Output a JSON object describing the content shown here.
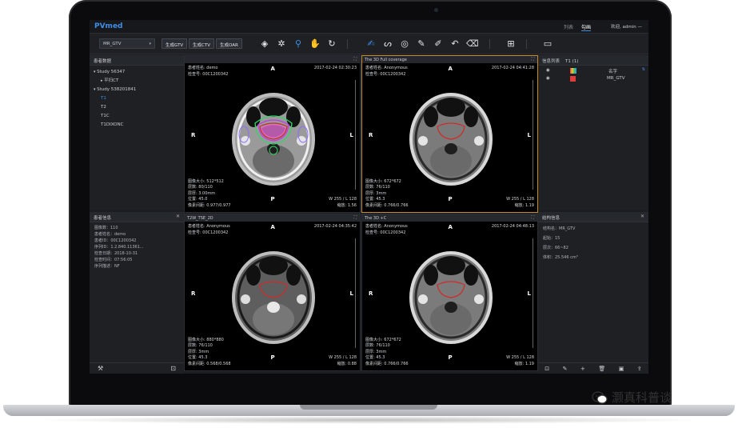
{
  "app": {
    "logo": "PVmed",
    "tabs": [
      "列表",
      "勾画"
    ],
    "active_tab": 1,
    "user": "欢迎, admin"
  },
  "toolbar": {
    "structure_select": "MR_GTV",
    "btn_gtv": "生成GTV",
    "btn_ctv": "生成CTV",
    "btn_oar": "生成OAR"
  },
  "patient_data": {
    "title": "患者数据",
    "items": [
      {
        "label": "Study 56347",
        "level": 0
      },
      {
        "label": "平扫CT",
        "level": 1
      },
      {
        "label": "Study 538201841",
        "level": 0
      },
      {
        "label": "T1",
        "level": 1
      },
      {
        "label": "T2",
        "level": 1
      },
      {
        "label": "T1C",
        "level": 1
      },
      {
        "label": "T1DIXONC",
        "level": 1
      }
    ]
  },
  "patient_info": {
    "title": "患者信息",
    "lines": [
      "图像数：110",
      "患者姓名：demo",
      "患者ID：00C1200342",
      "序列ID：1.2.840.11361...",
      "检查日期：2018-10-31",
      "检查时间：07:56:05",
      "序列描述：NF"
    ]
  },
  "viewports": [
    {
      "title": "",
      "name": "患者姓名: demo",
      "id": "检查号: 00C1200342",
      "datetime": "2017-02-24 02:30:23",
      "info": [
        "图像大小: 512*512",
        "层数: 80/110",
        "层厚: 3.00mm",
        "位置: 45.0",
        "像素间距: 0.977/0.977"
      ],
      "wl": "W 255 / L 128",
      "zoom": "缩放: 1.56",
      "modality": "ct"
    },
    {
      "title": "The 3D Full coverage",
      "name": "患者姓名: Anonymous",
      "id": "检查号: 00C1200342",
      "datetime": "2017-02-24 04:41:28",
      "info": [
        "图像大小: 672*672",
        "层数: 76/110",
        "层厚: 3mm",
        "位置: 45.3",
        "像素间距: 0.766/0.766"
      ],
      "wl": "W 255 / L 128",
      "zoom": "缩放: 1.19",
      "modality": "t1"
    },
    {
      "title": "T2W_TSE_2D",
      "name": "患者姓名: Anonymous",
      "id": "检查号: 00C1200342",
      "datetime": "2017-02-24 04:35:42",
      "info": [
        "图像大小: 880*880",
        "层数: 76/110",
        "层厚: 3mm",
        "位置: 45.3",
        "像素间距: 0.568/0.568"
      ],
      "wl": "W 255 / L 128",
      "zoom": "缩放: 0.88",
      "modality": "t2"
    },
    {
      "title": "The 3D +C",
      "name": "患者姓名: Anonymous",
      "id": "检查号: 00C1200342",
      "datetime": "2017-02-24 04:48:13",
      "info": [
        "图像大小: 672*672",
        "层数: 76/110",
        "层厚: 3mm",
        "位置: 45.3",
        "像素间距: 0.766/0.766"
      ],
      "wl": "W 255 / L 128",
      "zoom": "缩放: 1.19",
      "modality": "t1c"
    }
  ],
  "orientation": {
    "a": "A",
    "p": "P",
    "l": "L",
    "r": "R"
  },
  "info_list": {
    "title": "信息列表",
    "subtitle": "T1 (1)",
    "col_name": "名字",
    "rows": [
      {
        "name": "MR_GTV",
        "color": "#e23b3b"
      }
    ]
  },
  "structure_info": {
    "title": "结构信息",
    "lines": [
      "结构名：MR_GTV",
      "起始：15",
      "层次：66~82",
      "体积：25.546 cm³"
    ]
  },
  "watermark": "灏真科普谈",
  "colors": {
    "accent": "#3f8fe8",
    "selected_border": "#c98b2a",
    "gtv": "#e23b3b"
  }
}
